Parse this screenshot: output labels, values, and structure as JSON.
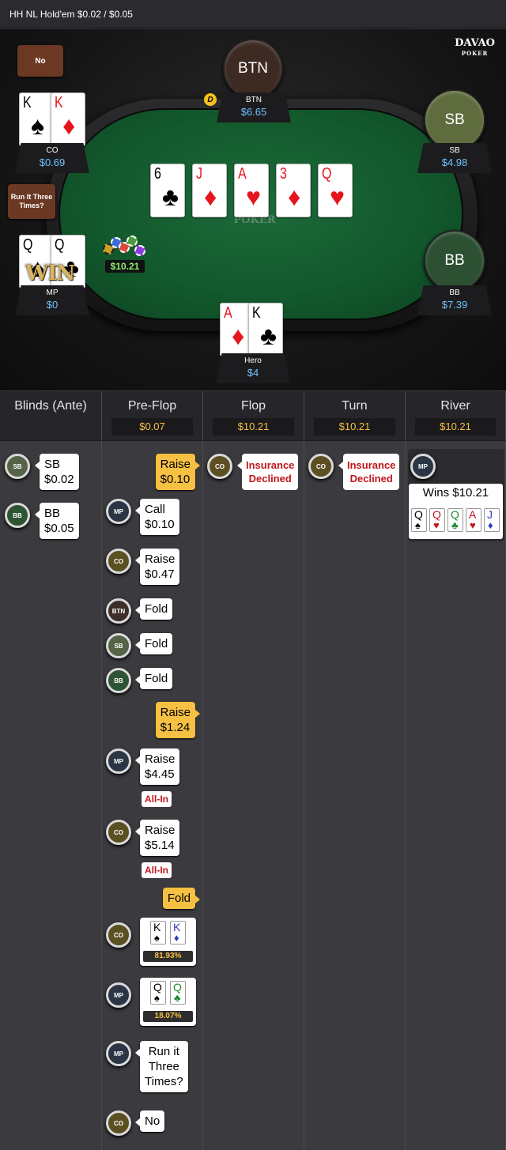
{
  "header": {
    "title": "HH NL Hold'em $0.02 / $0.05"
  },
  "brand": {
    "name": "DAVAO",
    "sub": "POKER"
  },
  "table": {
    "felt_logo": "POKER",
    "pot": "$10.21",
    "board": [
      {
        "rank": "6",
        "suit": "♣",
        "color": "black"
      },
      {
        "rank": "J",
        "suit": "♦",
        "color": "red"
      },
      {
        "rank": "A",
        "suit": "♥",
        "color": "red"
      },
      {
        "rank": "3",
        "suit": "♦",
        "color": "red"
      },
      {
        "rank": "Q",
        "suit": "♥",
        "color": "red"
      }
    ],
    "seats": {
      "btn": {
        "avatar": "BTN",
        "name": "BTN",
        "stack": "$6.65",
        "dealer": "D"
      },
      "sb": {
        "avatar": "SB",
        "name": "SB",
        "stack": "$4.98"
      },
      "bb": {
        "avatar": "BB",
        "name": "BB",
        "stack": "$7.39"
      },
      "co": {
        "name": "CO",
        "stack": "$0.69",
        "bubble": "No",
        "cards": [
          {
            "rank": "K",
            "suit": "♠",
            "color": "black"
          },
          {
            "rank": "K",
            "suit": "♦",
            "color": "red"
          }
        ]
      },
      "mp": {
        "name": "MP",
        "stack": "$0",
        "bubble": "Run It Three Times?",
        "win": "WIN",
        "cards": [
          {
            "rank": "Q",
            "suit": "♠",
            "color": "black"
          },
          {
            "rank": "Q",
            "suit": "♣",
            "color": "black"
          }
        ]
      },
      "hero": {
        "name": "Hero",
        "stack": "$4",
        "cards": [
          {
            "rank": "A",
            "suit": "♦",
            "color": "red"
          },
          {
            "rank": "K",
            "suit": "♣",
            "color": "black"
          }
        ]
      }
    }
  },
  "history": {
    "columns": [
      {
        "title": "Blinds (Ante)",
        "pot": ""
      },
      {
        "title": "Pre-Flop",
        "pot": "$0.07"
      },
      {
        "title": "Flop",
        "pot": "$10.21"
      },
      {
        "title": "Turn",
        "pot": "$10.21"
      },
      {
        "title": "River",
        "pot": "$10.21"
      }
    ],
    "blinds": [
      {
        "pos": "SB",
        "text": "SB\n$0.02"
      },
      {
        "pos": "BB",
        "text": "BB\n$0.05"
      }
    ],
    "preflop": [
      {
        "pos": "HERO",
        "text": "Raise\n$0.10"
      },
      {
        "pos": "MP",
        "text": "Call\n$0.10"
      },
      {
        "pos": "CO",
        "text": "Raise\n$0.47"
      },
      {
        "pos": "BTN",
        "text": "Fold"
      },
      {
        "pos": "SB",
        "text": "Fold"
      },
      {
        "pos": "BB",
        "text": "Fold"
      },
      {
        "pos": "HERO",
        "text": "Raise\n$1.24"
      },
      {
        "pos": "MP",
        "text": "Raise\n$4.45",
        "tag": "All-In"
      },
      {
        "pos": "CO",
        "text": "Raise\n$5.14",
        "tag": "All-In"
      },
      {
        "pos": "HERO",
        "text": "Fold"
      },
      {
        "pos": "CO",
        "equity": "81.93%",
        "cards": [
          {
            "rank": "K",
            "suit": "♠",
            "color": "#000"
          },
          {
            "rank": "K",
            "suit": "♦",
            "color": "#2a3fc4"
          }
        ]
      },
      {
        "pos": "MP",
        "equity": "18.07%",
        "cards": [
          {
            "rank": "Q",
            "suit": "♠",
            "color": "#000"
          },
          {
            "rank": "Q",
            "suit": "♣",
            "color": "#1f8a2c"
          }
        ]
      },
      {
        "pos": "MP",
        "text": "Run it\nThree\nTimes?"
      },
      {
        "pos": "CO",
        "text": "No"
      }
    ],
    "flop": [
      {
        "pos": "CO",
        "text": "Insurance\nDeclined"
      }
    ],
    "turn": [
      {
        "pos": "CO",
        "text": "Insurance\nDeclined"
      }
    ],
    "river": {
      "pos": "MP",
      "text": "Wins $10.21",
      "cards": [
        {
          "rank": "Q",
          "suit": "♠",
          "color": "#000"
        },
        {
          "rank": "Q",
          "suit": "♥",
          "color": "#c0161d"
        },
        {
          "rank": "Q",
          "suit": "♣",
          "color": "#1f8a2c"
        },
        {
          "rank": "A",
          "suit": "♥",
          "color": "#c0161d"
        },
        {
          "rank": "J",
          "suit": "♦",
          "color": "#2a3fc4"
        }
      ]
    }
  }
}
